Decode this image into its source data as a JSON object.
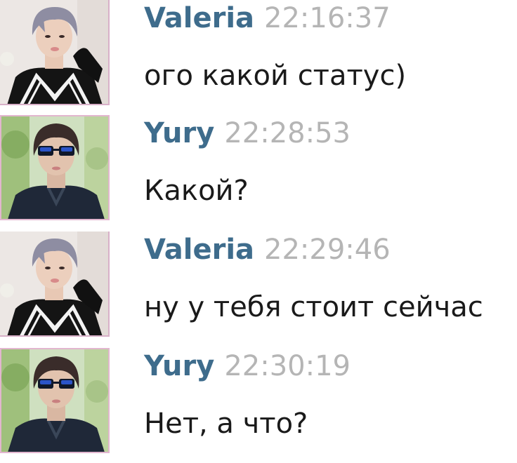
{
  "messages": [
    {
      "author": "Valeria",
      "time": "22:16:37",
      "text": "ого какой статус)",
      "avatar": "valeria-avatar"
    },
    {
      "author": "Yury",
      "time": "22:28:53",
      "text": "Какой?",
      "avatar": "yury-avatar"
    },
    {
      "author": "Valeria",
      "time": "22:29:46",
      "text": "ну у тебя стоит сейчас",
      "avatar": "valeria-avatar"
    },
    {
      "author": "Yury",
      "time": "22:30:19",
      "text": "Нет, а что?",
      "avatar": "yury-avatar"
    }
  ],
  "colors": {
    "author": "#3e6c8c",
    "timestamp": "#b5b5b5",
    "message_text": "#1a1a1a",
    "background": "#ffffff"
  }
}
